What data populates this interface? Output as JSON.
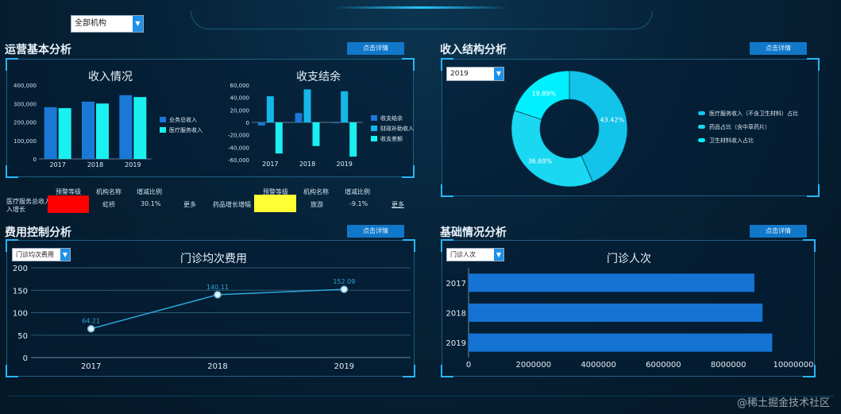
{
  "header": {
    "org_select": "全部机构"
  },
  "sections": {
    "operations": {
      "title": "运营基本分析",
      "button": "点击详情"
    },
    "income_structure": {
      "title": "收入结构分析",
      "button": "点击详情",
      "year_select": "2019"
    },
    "cost_control": {
      "title": "费用控制分析",
      "button": "点击详情",
      "select": "门诊均次费用"
    },
    "basic_info": {
      "title": "基础情况分析",
      "button": "点击详情",
      "select": "门诊人次"
    }
  },
  "table_row": {
    "headers_left": [
      "预警等级",
      "机构名称",
      "增减比例"
    ],
    "headers_right": [
      "预警等级",
      "机构名称",
      "增减比例"
    ],
    "label_left": "医疗服务总收入增长",
    "label_left_2": "入增长",
    "org_left": "虹桥",
    "ratio_left": "30.1%",
    "more_left": "更多",
    "label_right": "药品增长增幅",
    "org_right": "旅游",
    "ratio_right": "-9.1%",
    "more_right": "更多",
    "colors": {
      "alert_red": "#ff0000",
      "alert_yellow": "#ffff33"
    }
  },
  "watermark": "@稀土掘金技术社区",
  "chart_data": [
    {
      "type": "bar",
      "title": "收入情况",
      "categories": [
        "2017",
        "2018",
        "2019"
      ],
      "series": [
        {
          "name": "业务总收入",
          "values": [
            280000,
            310000,
            345000
          ],
          "color": "#1a78d6"
        },
        {
          "name": "医疗服务收入",
          "values": [
            275000,
            300000,
            335000
          ],
          "color": "#19f0f0"
        }
      ],
      "yticks": [
        "0",
        "100,000",
        "200,000",
        "300,000",
        "400,000"
      ],
      "ylim": [
        0,
        400000
      ],
      "legend": "right"
    },
    {
      "type": "bar",
      "title": "收支结余",
      "categories": [
        "2017",
        "2018",
        "2019"
      ],
      "series": [
        {
          "name": "收支结余",
          "values": [
            -5000,
            15000,
            -1000
          ],
          "color": "#1a78d6"
        },
        {
          "name": "财政补助收入",
          "values": [
            42000,
            53000,
            50000
          ],
          "color": "#15b7e8"
        },
        {
          "name": "收支差额",
          "values": [
            -50000,
            -38000,
            -55000
          ],
          "color": "#19f0f0"
        }
      ],
      "yticks": [
        "-60,000",
        "-40,000",
        "-20,000",
        "0",
        "20,000",
        "40,000",
        "60,000"
      ],
      "ylim": [
        -60000,
        60000
      ],
      "legend": "right"
    },
    {
      "type": "pie",
      "donut": true,
      "slices": [
        {
          "name": "医疗服务收入（不含卫生材料）占比",
          "value": 43.42,
          "label": "43.42%",
          "color": "#12c3ea"
        },
        {
          "name": "药品占比（含中草药片）",
          "value": 36.69,
          "label": "36.69%",
          "color": "#1ad8f2"
        },
        {
          "name": "卫生材料收入占比",
          "value": 19.89,
          "label": "19.89%",
          "color": "#00f0ff"
        }
      ],
      "legend": "right"
    },
    {
      "type": "line",
      "title": "门诊均次费用",
      "x": [
        "2017",
        "2018",
        "2019"
      ],
      "values": [
        64.21,
        140.11,
        152.09
      ],
      "labels": [
        "64.21",
        "140.11",
        "152.09"
      ],
      "yticks": [
        "0",
        "50",
        "100",
        "150",
        "200"
      ],
      "ylim": [
        0,
        200
      ],
      "grid": true
    },
    {
      "type": "bar",
      "orientation": "horizontal",
      "title": "门诊人次",
      "categories": [
        "2017",
        "2018",
        "2019"
      ],
      "values": [
        8800000,
        9050000,
        9350000
      ],
      "xticks": [
        "0",
        "2000000",
        "4000000",
        "6000000",
        "8000000",
        "10000000"
      ],
      "xlim": [
        0,
        10000000
      ],
      "color": "#1573d4"
    }
  ]
}
